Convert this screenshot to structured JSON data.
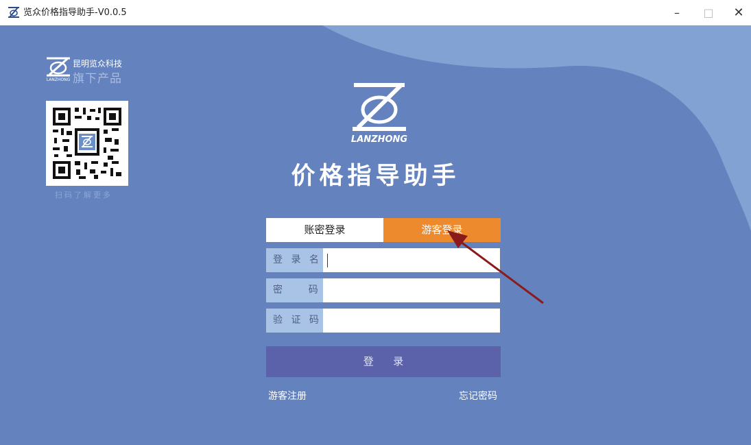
{
  "window": {
    "title": "览众价格指导助手-V0.0.5",
    "controls": {
      "minimize": "–",
      "maximize": "□",
      "close": "✕"
    }
  },
  "brand": {
    "company": "昆明览众科技",
    "subtitle": "旗下产品",
    "logo_text": "LANZHONG",
    "qr_caption": "扫码了解更多"
  },
  "header": {
    "logo_text": "LANZHONG",
    "title": "价格指导助手"
  },
  "tabs": [
    {
      "label": "账密登录",
      "active": false
    },
    {
      "label": "游客登录",
      "active": true
    }
  ],
  "form": {
    "username_label": "登 录 名",
    "password_label": "密    码",
    "captcha_label": "验 证 码",
    "username_value": "",
    "password_value": "",
    "captcha_value": ""
  },
  "login_button": "登      录",
  "links": {
    "register": "游客注册",
    "forgot": "忘记密码"
  },
  "colors": {
    "background": "#6382be",
    "accent_orange": "#ee8a2e",
    "login_button": "#5b62aa",
    "label_bg": "#a9c3e6",
    "arrow": "#8b1a1a"
  }
}
